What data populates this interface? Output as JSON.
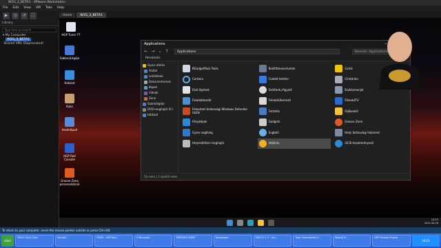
{
  "host": {
    "title": "W2G_3_BETA1 - VMware Workstation",
    "menu": [
      "File",
      "Edit",
      "View",
      "VM",
      "Tabs",
      "Help"
    ],
    "library_title": "Library",
    "library_search": "Type here to search",
    "library_items": [
      "My Computer",
      "W2G_3_BETA1",
      "Shared VMs (Deprecated)"
    ],
    "vm_tabs": [
      "Home",
      "W2G_3_BETA1"
    ],
    "status": "To return to your computer, move the mouse pointer outside or press Ctrl+Alt."
  },
  "desktop": {
    "icons": [
      "HGP Tuner YT",
      "Sablon/Légéje",
      "Hálózat",
      "Kuka",
      "Vezérlőpult",
      "HGP Red Console",
      "Groove Zene personalizáció"
    ]
  },
  "explorer": {
    "title": "Applications",
    "address": "Applications",
    "search_placeholder": "Keresés: Applications",
    "command": "Rendezés",
    "status": "56 elem  |  1 kijelölt elem",
    "nav": [
      {
        "label": "Gyors elérés",
        "group": true
      },
      {
        "label": "Asztal"
      },
      {
        "label": "Letöltések"
      },
      {
        "label": "Dokumentumok"
      },
      {
        "label": "Képek"
      },
      {
        "label": "Videók"
      },
      {
        "label": "Zene"
      },
      {
        "label": "Szám/légéje",
        "group": true
      },
      {
        "label": "DVD-meghajtó (E:)",
        "group": true
      },
      {
        "label": "Hálózat",
        "group": true
      }
    ],
    "apps": [
      "BGadgetPack Tools",
      "Beállítássesetvetek",
      "Carlik",
      "Cortana",
      "Csatolt telefon",
      "Címtárlan",
      "Első lépések",
      "Drótfordu-figyelő",
      "Eszközmenjár",
      "Feladatkezelő",
      "Feladatütemező",
      "FilmekéTV",
      "Felosztott biztonsági Windows Defender tűzfal",
      "Futtatás",
      "Fájlkezelő",
      "Fényképek",
      "Gadgets",
      "Groove Zene",
      "Gyors segítség",
      "Súgbóó",
      "Helyi biztonsági házirend",
      "Helyreállítási meghajtó",
      "Időjárás",
      "iSCSI-kezdeményező"
    ]
  },
  "guest_clock": {
    "time": "14:23",
    "date": "2021.08.28"
  },
  "host_taskbar": {
    "start": "start",
    "tasks": [
      "TMGC Guild Chat",
      "VirtualC...",
      "FIDSS - HSP Red...",
      "3 Microsoft...",
      "TMGDIAG WDRT",
      "Messenger",
      "OBS 27.1.3 - Vol...",
      "Total Commander 9...",
      "iNwnd] IV ...",
      "HSP Stream Engine"
    ],
    "clock": "20:23"
  },
  "colors": {
    "accent": "#2d6cc0",
    "window_bg": "#202020",
    "taskbar": "#2456c8"
  }
}
